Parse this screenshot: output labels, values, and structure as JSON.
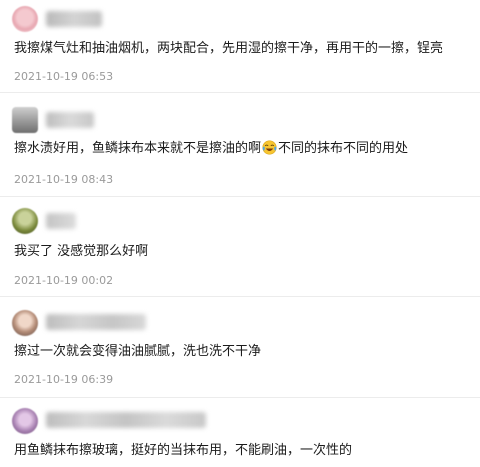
{
  "comments": [
    {
      "text": "我擦煤气灶和抽油烟机，两块配合，先用湿的擦干净，再用干的一擦，锃亮",
      "time": "2021-10-19 06:53"
    },
    {
      "text_before": "擦水渍好用，鱼鳞抹布本来就不是擦油的啊",
      "emoji": "laughing-crying-emoji",
      "text_after": "不同的抹布不同的用处",
      "time": "2021-10-19 08:43"
    },
    {
      "text": "我买了 没感觉那么好啊",
      "time": "2021-10-19 00:02"
    },
    {
      "text": "擦过一次就会变得油油腻腻，洗也洗不干净",
      "time": "2021-10-19 06:39"
    },
    {
      "text": "用鱼鳞抹布擦玻璃，挺好的当抹布用，不能刷油，一次性的"
    }
  ],
  "colors": {
    "timestamp": "#9a9a9a",
    "divider": "#ececec"
  }
}
